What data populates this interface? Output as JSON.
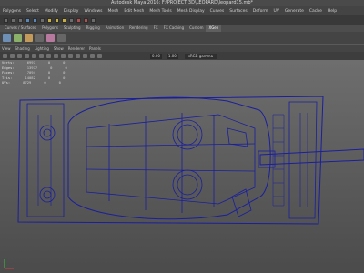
{
  "app": {
    "title": "Autodesk Maya 2016: F:\\PROJECT 3D\\LEOPARD\\leopard15.mb*"
  },
  "menubar": {
    "items": [
      "Polygons",
      "Select",
      "Modify",
      "Display",
      "Windows",
      "Mesh",
      "Edit Mesh",
      "Mesh Tools",
      "Mesh Display",
      "Curves",
      "Surfaces",
      "Deform",
      "UV",
      "Generate",
      "Cache",
      "Help"
    ]
  },
  "shelf": {
    "tabs": [
      "Curves / Surfaces",
      "Polygons",
      "Sculpting",
      "Rigging",
      "Animation",
      "Rendering",
      "FX",
      "FX Caching",
      "Custom",
      "XGen"
    ],
    "active_tab": "XGen"
  },
  "panel": {
    "menus": [
      "View",
      "Shading",
      "Lighting",
      "Show",
      "Renderer",
      "Panels"
    ],
    "exposure": "0.00",
    "gamma": "1.00",
    "color_space": "sRGB gamma"
  },
  "hud": {
    "rows": [
      {
        "label": "Verts:",
        "a": "6997",
        "b": "0",
        "c": "0"
      },
      {
        "label": "Edges:",
        "a": "13977",
        "b": "0",
        "c": "0"
      },
      {
        "label": "Faces:",
        "a": "7094",
        "b": "0",
        "c": "0"
      },
      {
        "label": "Tris:",
        "a": "14082",
        "b": "0",
        "c": "0"
      },
      {
        "label": "UVs:",
        "a": "8729",
        "b": "0",
        "c": "0"
      }
    ]
  },
  "colors": {
    "wire": "#1b1f9c",
    "viewport_top": "#6e6e6e",
    "viewport_bottom": "#4b4b4b",
    "accent": "#5a86b8"
  }
}
